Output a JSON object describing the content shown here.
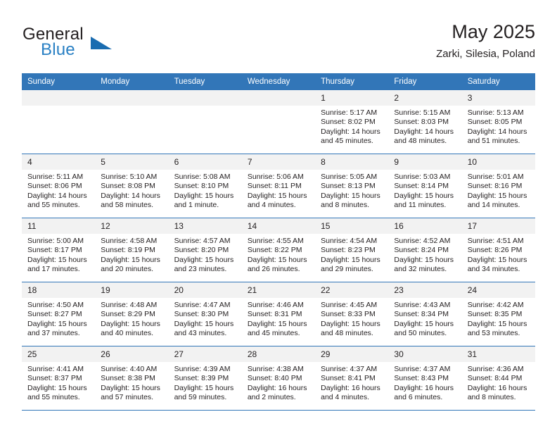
{
  "brand": {
    "word_one": "General",
    "word_two": "Blue",
    "triangle_color": "#1a6cb0",
    "blue_color": "#2980c4"
  },
  "header": {
    "title": "May 2025",
    "subtitle": "Zarki, Silesia, Poland"
  },
  "theme": {
    "header_bg": "#3276b8",
    "daynum_bg": "#f2f2f2",
    "border": "#3276b8",
    "text": "#231f20"
  },
  "weekdays": [
    "Sunday",
    "Monday",
    "Tuesday",
    "Wednesday",
    "Thursday",
    "Friday",
    "Saturday"
  ],
  "labels": {
    "sunrise_prefix": "Sunrise:",
    "sunset_prefix": "Sunset:",
    "daylight_prefix": "Daylight:"
  },
  "weeks": [
    [
      {
        "day": "",
        "empty": true,
        "sunrise": "",
        "sunset": "",
        "daylight_line1": "",
        "daylight_line2": ""
      },
      {
        "day": "",
        "empty": true,
        "sunrise": "",
        "sunset": "",
        "daylight_line1": "",
        "daylight_line2": ""
      },
      {
        "day": "",
        "empty": true,
        "sunrise": "",
        "sunset": "",
        "daylight_line1": "",
        "daylight_line2": ""
      },
      {
        "day": "",
        "empty": true,
        "sunrise": "",
        "sunset": "",
        "daylight_line1": "",
        "daylight_line2": ""
      },
      {
        "day": "1",
        "empty": false,
        "sunrise": "Sunrise: 5:17 AM",
        "sunset": "Sunset: 8:02 PM",
        "daylight_line1": "Daylight: 14 hours",
        "daylight_line2": "and 45 minutes."
      },
      {
        "day": "2",
        "empty": false,
        "sunrise": "Sunrise: 5:15 AM",
        "sunset": "Sunset: 8:03 PM",
        "daylight_line1": "Daylight: 14 hours",
        "daylight_line2": "and 48 minutes."
      },
      {
        "day": "3",
        "empty": false,
        "sunrise": "Sunrise: 5:13 AM",
        "sunset": "Sunset: 8:05 PM",
        "daylight_line1": "Daylight: 14 hours",
        "daylight_line2": "and 51 minutes."
      }
    ],
    [
      {
        "day": "4",
        "empty": false,
        "sunrise": "Sunrise: 5:11 AM",
        "sunset": "Sunset: 8:06 PM",
        "daylight_line1": "Daylight: 14 hours",
        "daylight_line2": "and 55 minutes."
      },
      {
        "day": "5",
        "empty": false,
        "sunrise": "Sunrise: 5:10 AM",
        "sunset": "Sunset: 8:08 PM",
        "daylight_line1": "Daylight: 14 hours",
        "daylight_line2": "and 58 minutes."
      },
      {
        "day": "6",
        "empty": false,
        "sunrise": "Sunrise: 5:08 AM",
        "sunset": "Sunset: 8:10 PM",
        "daylight_line1": "Daylight: 15 hours",
        "daylight_line2": "and 1 minute."
      },
      {
        "day": "7",
        "empty": false,
        "sunrise": "Sunrise: 5:06 AM",
        "sunset": "Sunset: 8:11 PM",
        "daylight_line1": "Daylight: 15 hours",
        "daylight_line2": "and 4 minutes."
      },
      {
        "day": "8",
        "empty": false,
        "sunrise": "Sunrise: 5:05 AM",
        "sunset": "Sunset: 8:13 PM",
        "daylight_line1": "Daylight: 15 hours",
        "daylight_line2": "and 8 minutes."
      },
      {
        "day": "9",
        "empty": false,
        "sunrise": "Sunrise: 5:03 AM",
        "sunset": "Sunset: 8:14 PM",
        "daylight_line1": "Daylight: 15 hours",
        "daylight_line2": "and 11 minutes."
      },
      {
        "day": "10",
        "empty": false,
        "sunrise": "Sunrise: 5:01 AM",
        "sunset": "Sunset: 8:16 PM",
        "daylight_line1": "Daylight: 15 hours",
        "daylight_line2": "and 14 minutes."
      }
    ],
    [
      {
        "day": "11",
        "empty": false,
        "sunrise": "Sunrise: 5:00 AM",
        "sunset": "Sunset: 8:17 PM",
        "daylight_line1": "Daylight: 15 hours",
        "daylight_line2": "and 17 minutes."
      },
      {
        "day": "12",
        "empty": false,
        "sunrise": "Sunrise: 4:58 AM",
        "sunset": "Sunset: 8:19 PM",
        "daylight_line1": "Daylight: 15 hours",
        "daylight_line2": "and 20 minutes."
      },
      {
        "day": "13",
        "empty": false,
        "sunrise": "Sunrise: 4:57 AM",
        "sunset": "Sunset: 8:20 PM",
        "daylight_line1": "Daylight: 15 hours",
        "daylight_line2": "and 23 minutes."
      },
      {
        "day": "14",
        "empty": false,
        "sunrise": "Sunrise: 4:55 AM",
        "sunset": "Sunset: 8:22 PM",
        "daylight_line1": "Daylight: 15 hours",
        "daylight_line2": "and 26 minutes."
      },
      {
        "day": "15",
        "empty": false,
        "sunrise": "Sunrise: 4:54 AM",
        "sunset": "Sunset: 8:23 PM",
        "daylight_line1": "Daylight: 15 hours",
        "daylight_line2": "and 29 minutes."
      },
      {
        "day": "16",
        "empty": false,
        "sunrise": "Sunrise: 4:52 AM",
        "sunset": "Sunset: 8:24 PM",
        "daylight_line1": "Daylight: 15 hours",
        "daylight_line2": "and 32 minutes."
      },
      {
        "day": "17",
        "empty": false,
        "sunrise": "Sunrise: 4:51 AM",
        "sunset": "Sunset: 8:26 PM",
        "daylight_line1": "Daylight: 15 hours",
        "daylight_line2": "and 34 minutes."
      }
    ],
    [
      {
        "day": "18",
        "empty": false,
        "sunrise": "Sunrise: 4:50 AM",
        "sunset": "Sunset: 8:27 PM",
        "daylight_line1": "Daylight: 15 hours",
        "daylight_line2": "and 37 minutes."
      },
      {
        "day": "19",
        "empty": false,
        "sunrise": "Sunrise: 4:48 AM",
        "sunset": "Sunset: 8:29 PM",
        "daylight_line1": "Daylight: 15 hours",
        "daylight_line2": "and 40 minutes."
      },
      {
        "day": "20",
        "empty": false,
        "sunrise": "Sunrise: 4:47 AM",
        "sunset": "Sunset: 8:30 PM",
        "daylight_line1": "Daylight: 15 hours",
        "daylight_line2": "and 43 minutes."
      },
      {
        "day": "21",
        "empty": false,
        "sunrise": "Sunrise: 4:46 AM",
        "sunset": "Sunset: 8:31 PM",
        "daylight_line1": "Daylight: 15 hours",
        "daylight_line2": "and 45 minutes."
      },
      {
        "day": "22",
        "empty": false,
        "sunrise": "Sunrise: 4:45 AM",
        "sunset": "Sunset: 8:33 PM",
        "daylight_line1": "Daylight: 15 hours",
        "daylight_line2": "and 48 minutes."
      },
      {
        "day": "23",
        "empty": false,
        "sunrise": "Sunrise: 4:43 AM",
        "sunset": "Sunset: 8:34 PM",
        "daylight_line1": "Daylight: 15 hours",
        "daylight_line2": "and 50 minutes."
      },
      {
        "day": "24",
        "empty": false,
        "sunrise": "Sunrise: 4:42 AM",
        "sunset": "Sunset: 8:35 PM",
        "daylight_line1": "Daylight: 15 hours",
        "daylight_line2": "and 53 minutes."
      }
    ],
    [
      {
        "day": "25",
        "empty": false,
        "sunrise": "Sunrise: 4:41 AM",
        "sunset": "Sunset: 8:37 PM",
        "daylight_line1": "Daylight: 15 hours",
        "daylight_line2": "and 55 minutes."
      },
      {
        "day": "26",
        "empty": false,
        "sunrise": "Sunrise: 4:40 AM",
        "sunset": "Sunset: 8:38 PM",
        "daylight_line1": "Daylight: 15 hours",
        "daylight_line2": "and 57 minutes."
      },
      {
        "day": "27",
        "empty": false,
        "sunrise": "Sunrise: 4:39 AM",
        "sunset": "Sunset: 8:39 PM",
        "daylight_line1": "Daylight: 15 hours",
        "daylight_line2": "and 59 minutes."
      },
      {
        "day": "28",
        "empty": false,
        "sunrise": "Sunrise: 4:38 AM",
        "sunset": "Sunset: 8:40 PM",
        "daylight_line1": "Daylight: 16 hours",
        "daylight_line2": "and 2 minutes."
      },
      {
        "day": "29",
        "empty": false,
        "sunrise": "Sunrise: 4:37 AM",
        "sunset": "Sunset: 8:41 PM",
        "daylight_line1": "Daylight: 16 hours",
        "daylight_line2": "and 4 minutes."
      },
      {
        "day": "30",
        "empty": false,
        "sunrise": "Sunrise: 4:37 AM",
        "sunset": "Sunset: 8:43 PM",
        "daylight_line1": "Daylight: 16 hours",
        "daylight_line2": "and 6 minutes."
      },
      {
        "day": "31",
        "empty": false,
        "sunrise": "Sunrise: 4:36 AM",
        "sunset": "Sunset: 8:44 PM",
        "daylight_line1": "Daylight: 16 hours",
        "daylight_line2": "and 8 minutes."
      }
    ]
  ]
}
